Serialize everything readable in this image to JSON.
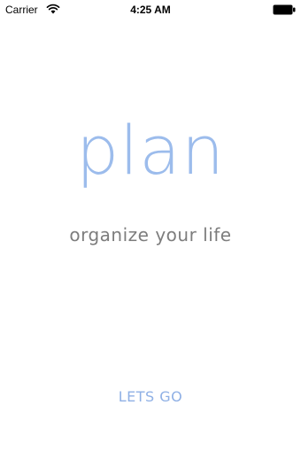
{
  "status_bar": {
    "carrier": "Carrier",
    "time": "4:25 AM",
    "icons": [
      "wifi-icon",
      "battery-icon"
    ]
  },
  "splash": {
    "logo": "plan",
    "tagline": "organize your life",
    "cta_label": "LETS GO"
  },
  "colors": {
    "accent": "#9cbcec",
    "tagline": "#7d7d7d",
    "background": "#ffffff"
  }
}
